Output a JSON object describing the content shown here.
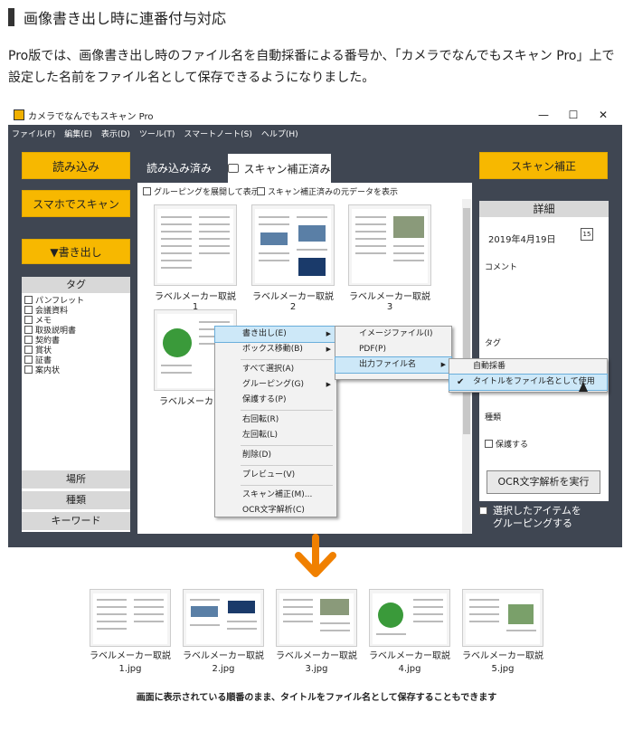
{
  "heading": "画像書き出し時に連番付与対応",
  "intro": "Pro版では、画像書き出し時のファイル名を自動採番による番号か、「カメラでなんでもスキャン Pro」上で設定した名前をファイル名として保存できるようになりました。",
  "app": {
    "title": "カメラでなんでもスキャン Pro",
    "window_controls": [
      "—",
      "☐",
      "✕"
    ],
    "menu": [
      "ファイル(F)",
      "編集(E)",
      "表示(D)",
      "ツール(T)",
      "スマートノート(S)",
      "ヘルプ(H)"
    ],
    "buttons": {
      "import": "読み込み",
      "phone_scan": "スマホでスキャン",
      "export": "▼書き出し",
      "scan_correct": "スキャン補正",
      "ocr": "OCR文字解析を実行"
    },
    "tabs": [
      "読み込み済み",
      "スキャン補正済み"
    ],
    "options": [
      "グルーピングを展開して表示",
      "スキャン補正済みの元データを表示"
    ],
    "tag_panel": {
      "header": "タグ",
      "items": [
        "パンフレット",
        "会議資料",
        "メモ",
        "取扱説明書",
        "契約書",
        "賞状",
        "証書",
        "案内状"
      ]
    },
    "side_buttons": [
      "場所",
      "種類",
      "キーワード"
    ],
    "thumbnails": [
      "ラベルメーカー取説1",
      "ラベルメーカー取説2",
      "ラベルメーカー取説3",
      "ラベルメーカー取"
    ],
    "details": {
      "header": "詳細",
      "date": "2019年4月19日",
      "calendar_day": "15",
      "comment_label": "コメント",
      "tag_label": "タグ",
      "type_label": "種類",
      "protect_label": "保護する"
    },
    "group_option": "選択したアイテムを\nグルーピングする",
    "context_menu": [
      "書き出し(E)",
      "ボックス移動(B)",
      "すべて選択(A)",
      "グルーピング(G)",
      "保護する(P)",
      "右回転(R)",
      "左回転(L)",
      "削除(D)",
      "プレビュー(V)",
      "スキャン補正(M)...",
      "OCR文字解析(C)"
    ],
    "submenu1": [
      "イメージファイル(I)",
      "PDF(P)",
      "出力ファイル名"
    ],
    "submenu2": [
      "自動採番",
      "タイトルをファイル名として使用"
    ]
  },
  "arrow_color": "#f08000",
  "bottom_thumbs": [
    {
      "name": "ラベルメーカー取説",
      "file": "1.jpg"
    },
    {
      "name": "ラベルメーカー取説",
      "file": "2.jpg"
    },
    {
      "name": "ラベルメーカー取説",
      "file": "3.jpg"
    },
    {
      "name": "ラベルメーカー取説",
      "file": "4.jpg"
    },
    {
      "name": "ラベルメーカー取説",
      "file": "5.jpg"
    }
  ],
  "note": "画面に表示されている順番のまま、タイトルをファイル名として保存することもできます"
}
